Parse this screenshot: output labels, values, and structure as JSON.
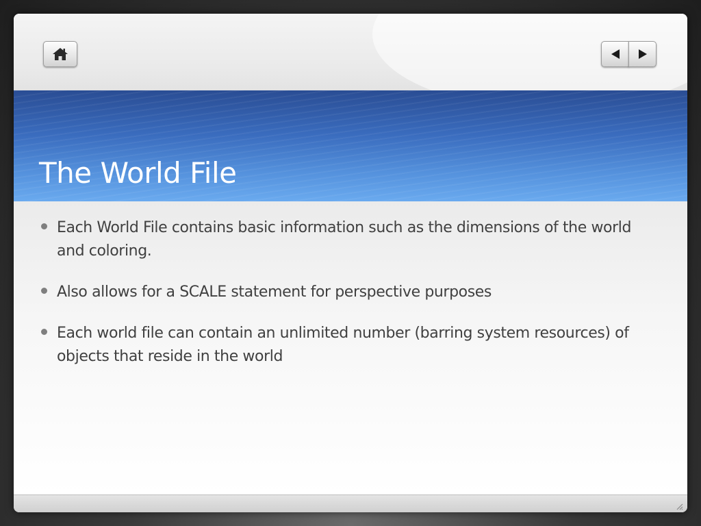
{
  "navigation": {
    "home_icon": "home-icon",
    "prev_icon": "triangle-left-icon",
    "next_icon": "triangle-right-icon"
  },
  "slide": {
    "title": "The World File",
    "bullets": [
      "Each World File contains basic information such as the dimensions of the world and coloring.",
      "Also allows for a SCALE statement for perspective purposes",
      "Each world file can contain an unlimited number (barring system resources) of objects that reside in the world"
    ]
  },
  "colors": {
    "title_band_top": "#2a4d94",
    "title_band_bottom": "#6aaaef",
    "text": "#404040",
    "bullet": "#7f7f7f"
  }
}
